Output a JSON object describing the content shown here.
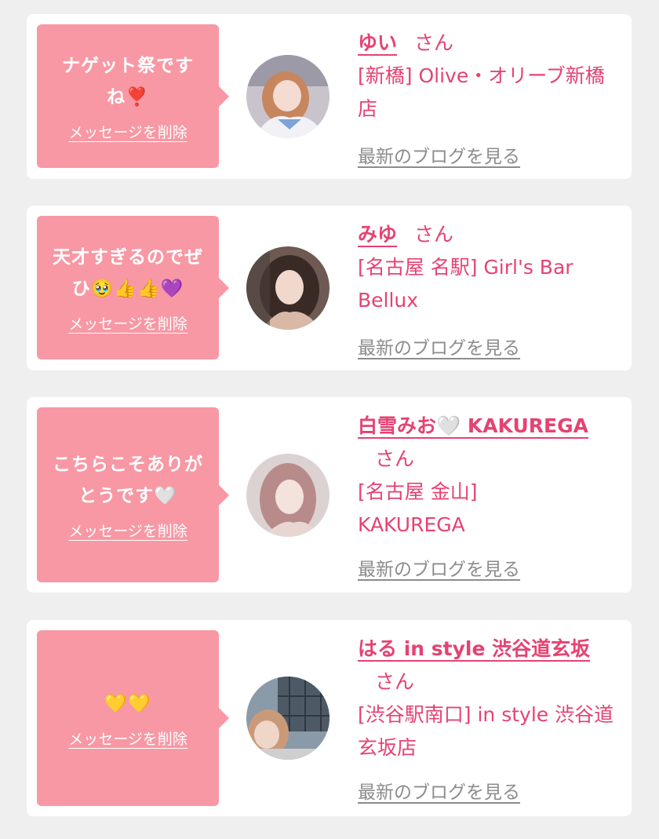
{
  "cards": [
    {
      "message": "ナゲット祭ですね❣️",
      "delete_label": "メッセージを削除",
      "name": "ゆい",
      "honorific": "さん",
      "shop": "[新橋] Olive・オリーブ新橋店",
      "blog_label": "最新のブログを見る"
    },
    {
      "message": "天才すぎるのでぜひ🥹👍👍💜",
      "delete_label": "メッセージを削除",
      "name": "みゆ",
      "honorific": "さん",
      "shop": "[名古屋 名駅] Girl's Bar Bellux",
      "blog_label": "最新のブログを見る"
    },
    {
      "message": "こちらこそありがとうです🤍",
      "delete_label": "メッセージを削除",
      "name": "白雪みお🤍 KAKUREGA",
      "honorific": "さん",
      "shop": "[名古屋 金山] KAKUREGA",
      "blog_label": "最新のブログを見る"
    },
    {
      "message": "💛💛",
      "delete_label": "メッセージを削除",
      "name": "はる in style 渋谷道玄坂",
      "honorific": "さん",
      "shop": "[渋谷駅南口] in style 渋谷道玄坂店",
      "blog_label": "最新のブログを見る"
    }
  ],
  "colors": {
    "bubble": "#f898a4",
    "accent": "#e64272",
    "muted_link": "#8c8c8c",
    "background": "#efefef"
  }
}
